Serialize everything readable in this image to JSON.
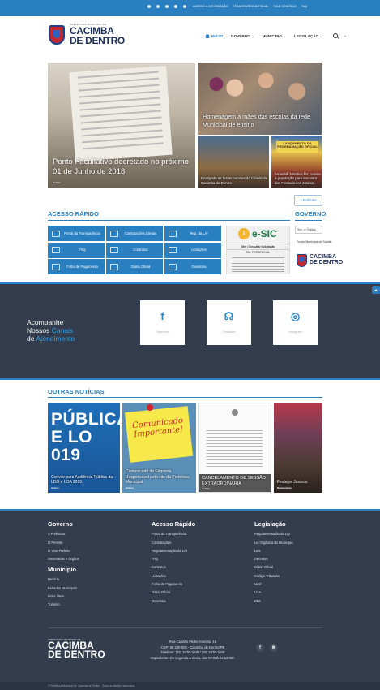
{
  "topbar": {
    "accessibility": [
      "A+",
      "A-",
      "◐",
      "◑",
      "☰"
    ],
    "links": [
      "ACESSO À INFORMAÇÃO",
      "TRANSPARÊNCIA FISCAL",
      "FALE CONOSCO",
      "FAQ"
    ]
  },
  "header": {
    "brand_small": "PREFEITURA MUNICIPAL DE",
    "brand_name_1": "CACIMBA",
    "brand_name_2": "DE DENTRO",
    "nav": [
      "INÍCIO",
      "GOVERNO ⌄",
      "MUNICÍPIO ⌄",
      "LEGISLAÇÃO ⌄"
    ],
    "more": "⌄"
  },
  "hero": {
    "main_caption": "Ponto Facultativo decretado no próximo 01 de Junho de 2018",
    "main_tag": "Avisos",
    "right_top_caption": "Homenagem a mães das escolas da rede Municipal de ensino",
    "right_bl_caption": "Divulgado as festas Juninas da Cidade de Cacimba de Dentro",
    "right_br_caption": "Amanhã: Natalice faz convite à população para encontro dos Festivaleiros Juninos",
    "right_br_banner": "LANÇAMENTO DA PROGRAMAÇÃO OFICIAL"
  },
  "more_news_button": "+ Notícias",
  "acesso_rapido": {
    "title": "ACESSO RÁPIDO",
    "items": [
      "Portal da Transparência",
      "Contratações Diretas",
      "Reg. da LAI",
      "FAQ",
      "Contratos",
      "Licitações",
      "Folha de Pagamento",
      "Diário Oficial",
      "Ouvidoria"
    ]
  },
  "esic": {
    "icon": "i",
    "word": "e-SIC",
    "line1": "Sfer | Consultar Solicitação",
    "line2": "SIC PRESENCIAL"
  },
  "governo": {
    "title": "GOVERNO",
    "select": "Sec. e Órgãos",
    "link": "Fundo Municipal de Saúde",
    "logo_1": "CACIMBA",
    "logo_2": "DE DENTRO"
  },
  "social": {
    "title_1": "Acompanhe",
    "title_2a": "Nossos ",
    "title_2b": "Canais",
    "title_3a": "de ",
    "title_3b": "Atendimento",
    "cards": [
      {
        "glyph": "f",
        "label": "Facebook"
      },
      {
        "glyph": "☊",
        "label": "Ouvidoria"
      },
      {
        "glyph": "◎",
        "label": "Instagram"
      }
    ]
  },
  "outras": {
    "title": "OUTRAS NOTÍCIAS",
    "cards": [
      {
        "image_text_1": "PÚBLICA",
        "image_text_2": "E LO",
        "image_text_3": "019",
        "caption": "Convite para Audiência Pública da LDO e LOA 2019",
        "tag": "Avisos"
      },
      {
        "image_text": "Comunicado Importante!",
        "caption": "Comunicado da Empresa Responsável pelo site da Prefeitura Municipal",
        "tag": "Avisos"
      },
      {
        "caption": "CANCELAMENTO DE SESSÃO EXTRAORDINÁRIA",
        "tag": "Avisos"
      },
      {
        "caption": "Festejos Juninos",
        "tag": "Desenvolver"
      }
    ]
  },
  "footer": {
    "col1_title": "Governo",
    "col1_links": [
      "A Prefeitura",
      "O Prefeito",
      "O Vice-Prefeito",
      "Secretarias e Órgãos"
    ],
    "col1b_title": "Município",
    "col1b_links": [
      "História",
      "Feriados Municipais",
      "Links Úteis",
      "Turismo"
    ],
    "col2_title": "Acesso Rápido",
    "col2_links": [
      "Portal da Transparência",
      "Contratações",
      "Regulamentação da LAI",
      "FAQ",
      "Contratos",
      "Licitações",
      "Folha de Pagamento",
      "Diário Oficial",
      "Ouvidoria"
    ],
    "col3_title": "Legislação",
    "col3_links": [
      "Regulamentação da LAI",
      "Lei Orgânica do Município",
      "Leis",
      "Decretos",
      "Diário Oficial",
      "Código Tributário",
      "LDO",
      "LOA",
      "PPA"
    ],
    "logo_small": "PREFEITURA MUNICIPAL DE",
    "logo_1": "CACIMBA",
    "logo_2": "DE DENTRO",
    "address_1": "Rua Capitão Pedro Honório, 15",
    "address_2": "CEP: 58.230-000 - Cacimba de Dentro/PB",
    "address_3": "Telefone: (83) 3379-1045 / (83) 3379-1046",
    "address_4": "Expediente: De segunda à sexta, das 07:00h às 13:00h",
    "social": [
      "f",
      "✉"
    ],
    "bottom": "© Prefeitura Municipal de Cacimba de Dentro - Todos os direitos reservados"
  }
}
